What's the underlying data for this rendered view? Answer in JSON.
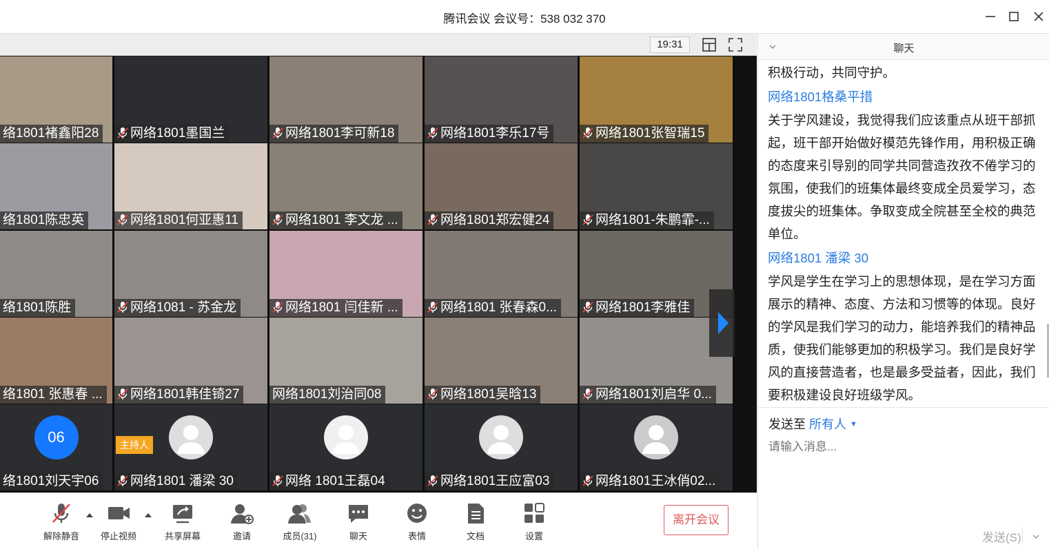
{
  "window": {
    "title": "腾讯会议 会议号：538 032 370"
  },
  "topbar": {
    "time": "19:31"
  },
  "tiles": [
    {
      "name": "络1801褚鑫阳28",
      "mic": false,
      "bg": "#a79a86"
    },
    {
      "name": "网络1801墨国兰",
      "mic": true,
      "bg": "#2b2d31"
    },
    {
      "name": "网络1801李可新18",
      "mic": true,
      "bg": "#8a8076"
    },
    {
      "name": "网络1801李乐17号",
      "mic": true,
      "bg": "#575151"
    },
    {
      "name": "网络1801张智瑞15",
      "mic": true,
      "bg": "#a5803e"
    },
    {
      "name": "络1801陈忠英",
      "mic": false,
      "bg": "#9c9ba1"
    },
    {
      "name": "网络1801何亚惠11",
      "mic": true,
      "bg": "#d5c9c0"
    },
    {
      "name": "网络1801 李文龙 ...",
      "mic": true,
      "bg": "#888276"
    },
    {
      "name": "网络1801郑宏健24",
      "mic": true,
      "bg": "#7a6a5e"
    },
    {
      "name": "网络1801-朱鹏霏-...",
      "mic": true,
      "bg": "#4a4847"
    },
    {
      "name": "络1801陈胜",
      "mic": false,
      "bg": "#8d8a87"
    },
    {
      "name": "网络1081 - 苏金龙",
      "mic": true,
      "bg": "#8f8a86"
    },
    {
      "name": "网络1801 闫佳新 ...",
      "mic": true,
      "bg": "#c8a7b0"
    },
    {
      "name": "网络1801 张春森0...",
      "mic": true,
      "bg": "#817974"
    },
    {
      "name": "网络1801李雅佳",
      "mic": true,
      "bg": "#6e6862"
    },
    {
      "name": "络1801 张惠春 ...",
      "mic": false,
      "bg": "#9a7b66"
    },
    {
      "name": "网络1801韩佳锜27",
      "mic": true,
      "bg": "#9a938f"
    },
    {
      "name": "网络1801刘治同08",
      "mic": false,
      "bg": "#a7a39c"
    },
    {
      "name": "网络1801吴晗13",
      "mic": true,
      "bg": "#8b7e74"
    },
    {
      "name": "网络1801刘启华 0...",
      "mic": true,
      "bg": "#938f8b"
    },
    {
      "name": "络1801刘天宇06",
      "mic": false,
      "bg": "#2b2d31",
      "avatar": "06",
      "avatarColor": "#1677ff"
    },
    {
      "name": "网络1801 潘梁 30",
      "mic": true,
      "bg": "#2b2d31",
      "avatar": "",
      "avatarColor": "#dedede"
    },
    {
      "name": "网络 1801王磊04",
      "mic": true,
      "bg": "#2b2d31",
      "avatar": "",
      "avatarColor": "#f0f0f0"
    },
    {
      "name": "网络1801王应富03",
      "mic": true,
      "bg": "#2b2d31",
      "avatar": "",
      "avatarColor": "#dedede"
    },
    {
      "name": "网络1801王冰俏02...",
      "mic": true,
      "bg": "#2b2d31",
      "avatar": "",
      "avatarColor": "#cccccc"
    }
  ],
  "host_badge": "主持人",
  "toolbar": {
    "items": [
      {
        "label": "解除静音",
        "icon": "mic-muted-icon"
      },
      {
        "label": "停止视频",
        "icon": "video-camera-icon"
      },
      {
        "label": "共享屏幕",
        "icon": "share-screen-icon"
      },
      {
        "label": "邀请",
        "icon": "invite-user-icon"
      },
      {
        "label": "成员(31)",
        "icon": "members-icon"
      },
      {
        "label": "聊天",
        "icon": "chat-bubble-icon"
      },
      {
        "label": "表情",
        "icon": "emoji-icon"
      },
      {
        "label": "文档",
        "icon": "document-icon"
      },
      {
        "label": "设置",
        "icon": "settings-grid-icon"
      }
    ],
    "leave_label": "离开会议"
  },
  "chat": {
    "title": "聊天",
    "messages": [
      {
        "sender": "",
        "text": "积极行动，共同守护。"
      },
      {
        "sender": "网络1801格桑平措",
        "text": "关于学风建设，我觉得我们应该重点从班干部抓起，班干部开始做好模范先锋作用，用积极正确的态度来引导别的同学共同营造孜孜不倦学习的氛围，使我们的班集体最终变成全员爱学习，态度拔尖的班集体。争取变成全院甚至全校的典范单位。"
      },
      {
        "sender": "网络1801 潘梁 30",
        "text": "学风是学生在学习上的思想体现，是在学习方面展示的精神、态度、方法和习惯等的体现。良好的学风是我们学习的动力，能培养我们的精神品质，使我们能够更加的积极学习。我们是良好学风的直接营造者，也是最多受益者，因此，我们要积极建设良好班级学风。"
      }
    ],
    "send_to_label": "发送至",
    "send_to_target": "所有人",
    "input_placeholder": "请输入消息...",
    "send_label": "发送(S)"
  },
  "colors": {
    "accent": "#2a7de1",
    "leave": "#e05b5b",
    "host_badge": "#f5a623"
  }
}
